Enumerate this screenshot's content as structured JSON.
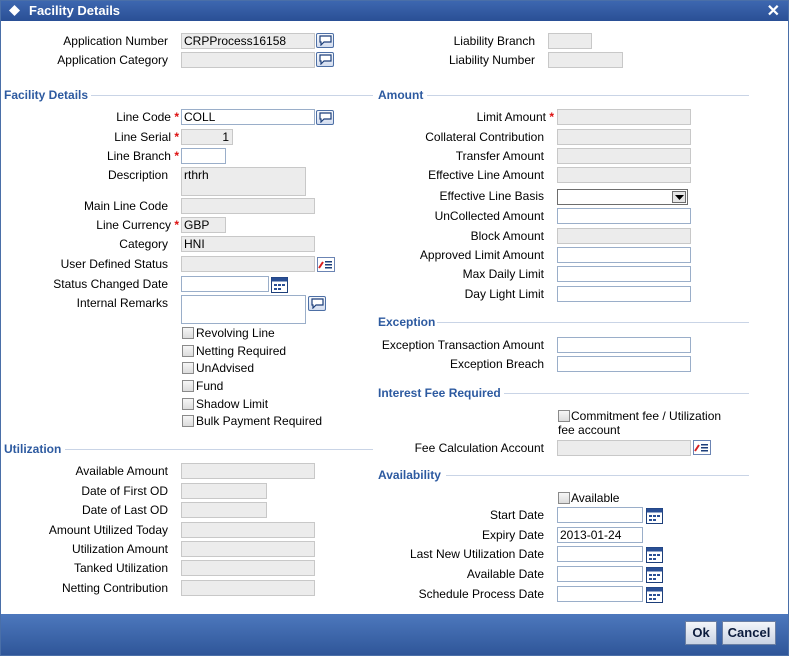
{
  "window": {
    "title": "Facility Details",
    "close_glyph": "✕"
  },
  "header": {
    "application_number": {
      "label": "Application Number",
      "value": "CRPProcess16158"
    },
    "application_category": {
      "label": "Application Category",
      "value": ""
    },
    "liability_branch": {
      "label": "Liability Branch",
      "value": ""
    },
    "liability_number": {
      "label": "Liability Number",
      "value": ""
    }
  },
  "facility": {
    "section_title": "Facility Details",
    "line_code": {
      "label": "Line Code",
      "value": "COLL"
    },
    "line_serial": {
      "label": "Line Serial",
      "value": "1"
    },
    "line_branch": {
      "label": "Line Branch",
      "value": ""
    },
    "description": {
      "label": "Description",
      "value": "rthrh"
    },
    "main_line_code": {
      "label": "Main Line Code",
      "value": ""
    },
    "line_currency": {
      "label": "Line Currency",
      "value": "GBP"
    },
    "category": {
      "label": "Category",
      "value": "HNI"
    },
    "user_defined_status": {
      "label": "User Defined Status",
      "value": ""
    },
    "status_changed_date": {
      "label": "Status Changed Date",
      "value": ""
    },
    "internal_remarks": {
      "label": "Internal Remarks",
      "value": ""
    },
    "checkboxes": [
      {
        "label": "Revolving Line",
        "checked": false
      },
      {
        "label": "Netting Required",
        "checked": false
      },
      {
        "label": "UnAdvised",
        "checked": false
      },
      {
        "label": "Fund",
        "checked": false
      },
      {
        "label": "Shadow Limit",
        "checked": false
      },
      {
        "label": "Bulk Payment Required",
        "checked": false
      }
    ]
  },
  "utilization": {
    "section_title": "Utilization",
    "available_amount": {
      "label": "Available Amount",
      "value": ""
    },
    "date_first_od": {
      "label": "Date of First OD",
      "value": ""
    },
    "date_last_od": {
      "label": "Date of Last OD",
      "value": ""
    },
    "amount_utilized_today": {
      "label": "Amount Utilized Today",
      "value": ""
    },
    "utilization_amount": {
      "label": "Utilization Amount",
      "value": ""
    },
    "tanked_utilization": {
      "label": "Tanked Utilization",
      "value": ""
    },
    "netting_contribution": {
      "label": "Netting Contribution",
      "value": ""
    }
  },
  "amount": {
    "section_title": "Amount",
    "limit_amount": {
      "label": "Limit Amount",
      "value": ""
    },
    "collateral_contribution": {
      "label": "Collateral Contribution",
      "value": ""
    },
    "transfer_amount": {
      "label": "Transfer Amount",
      "value": ""
    },
    "effective_line_amount": {
      "label": "Effective Line Amount",
      "value": ""
    },
    "effective_line_basis": {
      "label": "Effective Line Basis",
      "value": ""
    },
    "uncollected_amount": {
      "label": "UnCollected Amount",
      "value": ""
    },
    "block_amount": {
      "label": "Block Amount",
      "value": ""
    },
    "approved_limit_amount": {
      "label": "Approved Limit Amount",
      "value": ""
    },
    "max_daily_limit": {
      "label": "Max Daily Limit",
      "value": ""
    },
    "day_light_limit": {
      "label": "Day Light Limit",
      "value": ""
    }
  },
  "exception": {
    "section_title": "Exception",
    "transaction_amount": {
      "label": "Exception Transaction Amount",
      "value": ""
    },
    "breach": {
      "label": "Exception Breach",
      "value": ""
    }
  },
  "interest_fee": {
    "section_title": "Interest Fee Required",
    "commitment_fee_line1": "Commitment fee / Utilization",
    "commitment_fee_line2": "fee account",
    "fee_calculation_account": {
      "label": "Fee Calculation Account",
      "value": ""
    }
  },
  "availability": {
    "section_title": "Availability",
    "available_label": "Available",
    "start_date": {
      "label": "Start Date",
      "value": ""
    },
    "expiry_date": {
      "label": "Expiry Date",
      "value": "2013-01-24"
    },
    "last_new_utilization_date": {
      "label": "Last New Utilization Date",
      "value": ""
    },
    "available_date": {
      "label": "Available Date",
      "value": ""
    },
    "schedule_process_date": {
      "label": "Schedule Process Date",
      "value": ""
    }
  },
  "footer": {
    "ok_label": "Ok",
    "cancel_label": "Cancel"
  },
  "colors": {
    "title_bar": "#2f5699",
    "section_heading": "#2d5aa0",
    "required_star": "#dd1111"
  }
}
